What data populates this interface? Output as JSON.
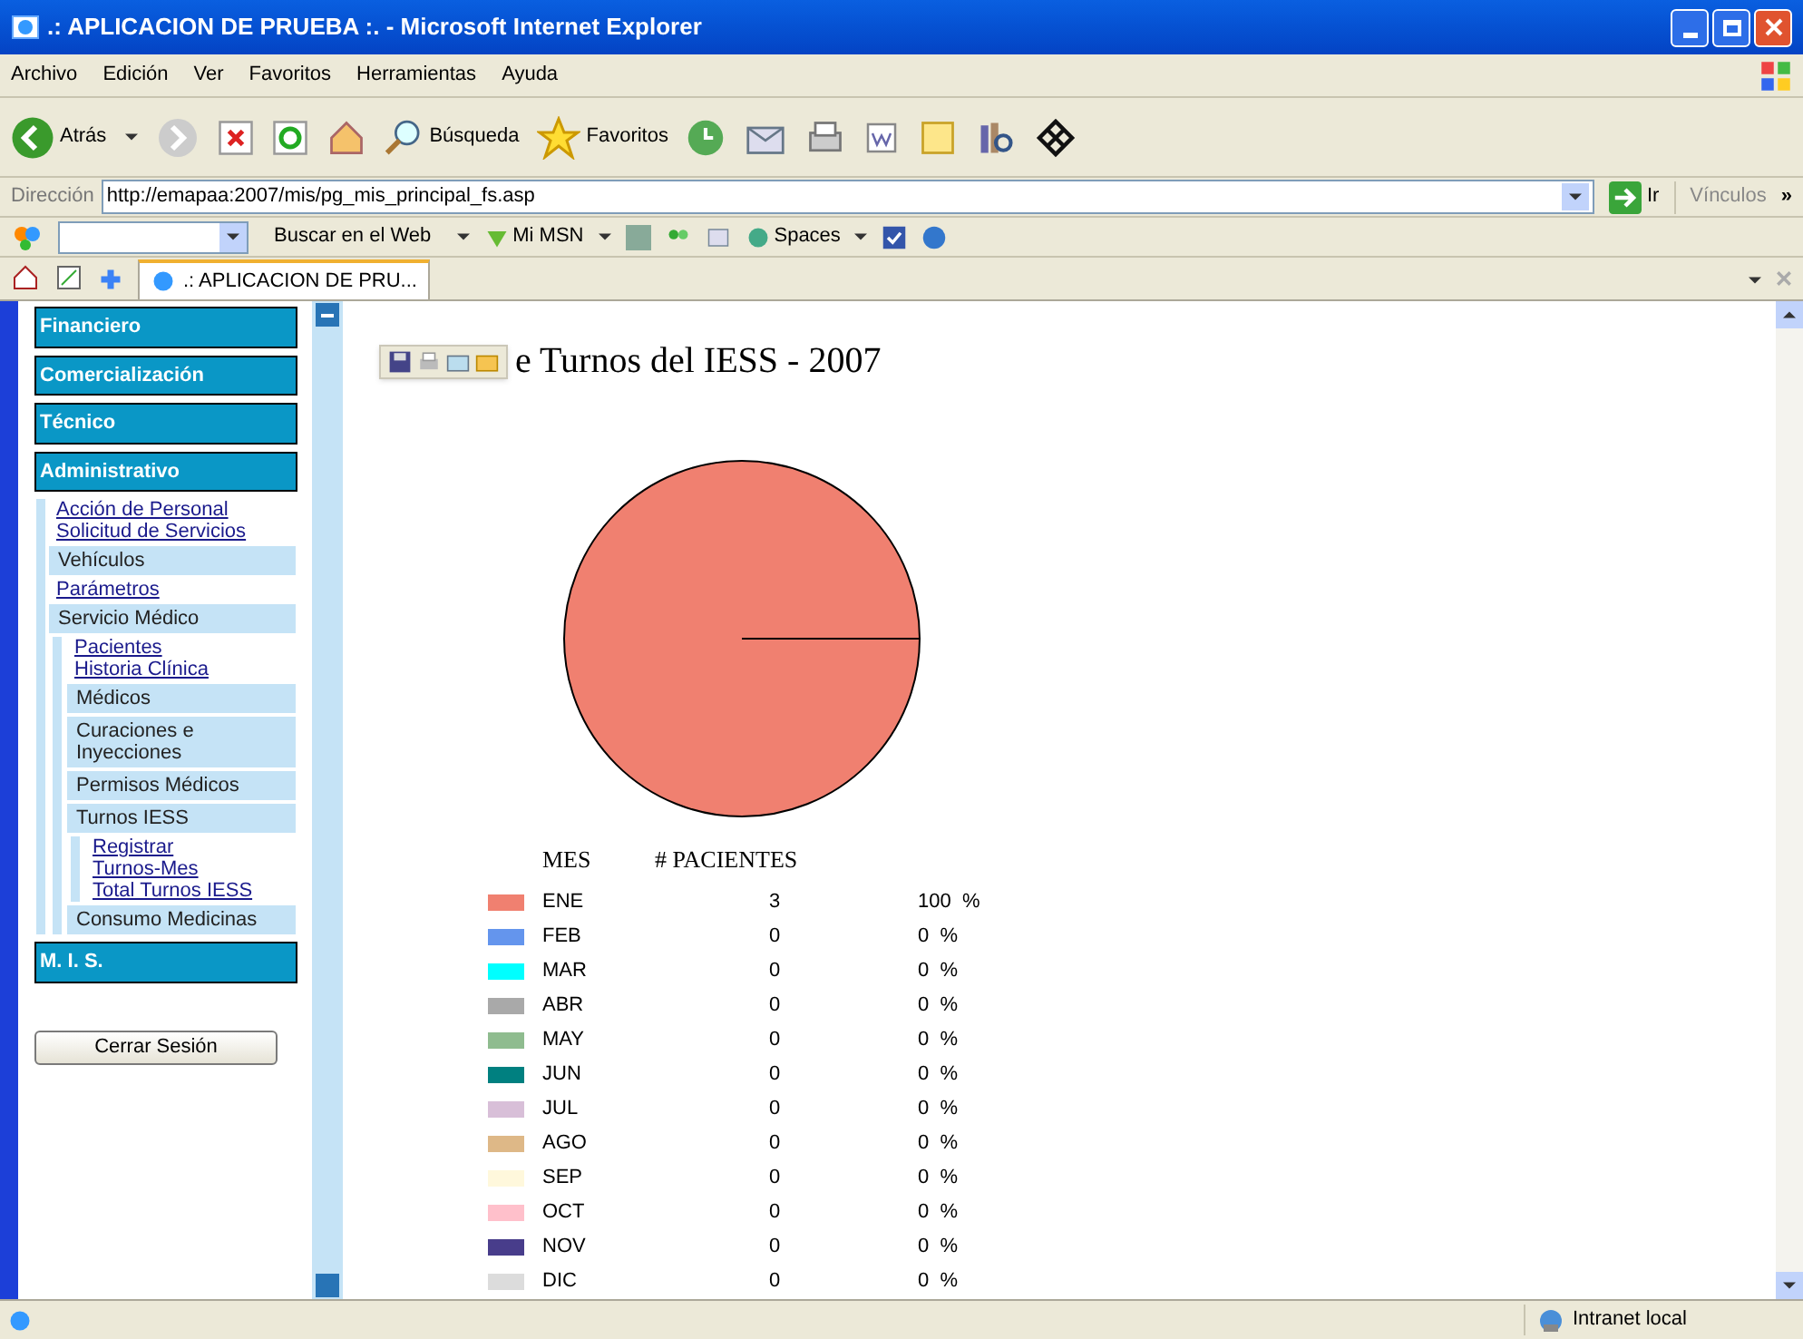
{
  "window": {
    "title": ".: APLICACION DE PRUEBA :. - Microsoft Internet Explorer"
  },
  "menu": [
    "Archivo",
    "Edición",
    "Ver",
    "Favoritos",
    "Herramientas",
    "Ayuda"
  ],
  "toolbar": {
    "back": "Atrás",
    "search": "Búsqueda",
    "favorites": "Favoritos"
  },
  "address": {
    "label": "Dirección",
    "url": "http://emapaa:2007/mis/pg_mis_principal_fs.asp",
    "go": "Ir",
    "links": "Vínculos",
    "more": "»"
  },
  "search_toolbar": {
    "search_web": "Buscar en el Web",
    "msn": "Mi MSN",
    "spaces": "Spaces"
  },
  "tabs": [
    {
      "label": ".: APLICACION DE PRU...",
      "selected": true
    }
  ],
  "sidebar": {
    "items": [
      {
        "kind": "header",
        "label": "Financiero"
      },
      {
        "kind": "header",
        "label": "Comercialización"
      },
      {
        "kind": "header",
        "label": "Técnico"
      },
      {
        "kind": "header",
        "label": "Administrativo",
        "children": [
          {
            "kind": "link",
            "label": "Acción de Personal"
          },
          {
            "kind": "link",
            "label": "Solicitud de Servicios"
          },
          {
            "kind": "group",
            "label": "Vehículos"
          },
          {
            "kind": "link",
            "label": "Parámetros"
          },
          {
            "kind": "group",
            "label": "Servicio Médico",
            "children": [
              {
                "kind": "link",
                "label": "Pacientes"
              },
              {
                "kind": "link",
                "label": "Historia Clínica"
              },
              {
                "kind": "group",
                "label": "Médicos"
              },
              {
                "kind": "group",
                "label": "Curaciones e Inyecciones"
              },
              {
                "kind": "group",
                "label": "Permisos Médicos"
              },
              {
                "kind": "group",
                "label": "Turnos IESS",
                "children": [
                  {
                    "kind": "link",
                    "label": "Registrar"
                  },
                  {
                    "kind": "link",
                    "label": "Turnos-Mes"
                  },
                  {
                    "kind": "link",
                    "label": "Total Turnos IESS"
                  }
                ]
              },
              {
                "kind": "group",
                "label": "Consumo Medicinas"
              }
            ]
          }
        ]
      },
      {
        "kind": "header",
        "label": "M. I. S."
      }
    ],
    "logout": "Cerrar Sesión"
  },
  "report": {
    "title": "e Turnos del IESS - 2007",
    "chart_data": {
      "type": "pie",
      "categories": [
        "ENE",
        "FEB",
        "MAR",
        "ABR",
        "MAY",
        "JUN",
        "JUL",
        "AGO",
        "SEP",
        "OCT",
        "NOV",
        "DIC"
      ],
      "values": [
        100,
        0,
        0,
        0,
        0,
        0,
        0,
        0,
        0,
        0,
        0,
        0
      ]
    },
    "legend_headers": [
      "MES",
      "# PACIENTES"
    ],
    "legend": [
      {
        "count": "3",
        "percent": "100  %",
        "color": "#f08070"
      },
      {
        "count": "0",
        "percent": "0  %",
        "color": "#6495ed"
      },
      {
        "count": "0",
        "percent": "0  %",
        "color": "#00ffff"
      },
      {
        "count": "0",
        "percent": "0  %",
        "color": "#a9a9a9"
      },
      {
        "count": "0",
        "percent": "0  %",
        "color": "#8fbc8f"
      },
      {
        "count": "0",
        "percent": "0  %",
        "color": "#008080"
      },
      {
        "count": "0",
        "percent": "0  %",
        "color": "#d8bfd8"
      },
      {
        "count": "0",
        "percent": "0  %",
        "color": "#deb887"
      },
      {
        "count": "0",
        "percent": "0  %",
        "color": "#fff8dc"
      },
      {
        "count": "0",
        "percent": "0  %",
        "color": "#ffc0cb"
      },
      {
        "count": "0",
        "percent": "0  %",
        "color": "#483d8b"
      },
      {
        "count": "0",
        "percent": "0  %",
        "color": "#dcdcdc"
      }
    ]
  },
  "status_bar": {
    "zone": "Intranet local"
  }
}
